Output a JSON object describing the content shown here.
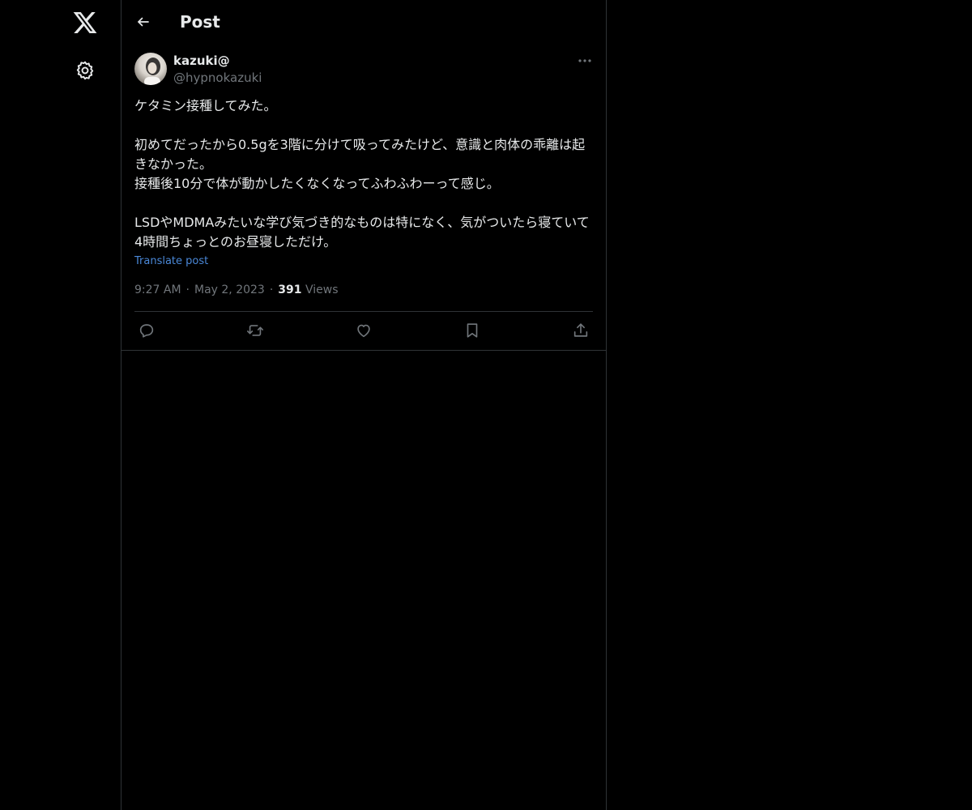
{
  "nav": {
    "logo_icon": "x-logo-icon",
    "settings_icon": "gear-icon"
  },
  "header": {
    "back_icon": "arrow-left-icon",
    "title": "Post"
  },
  "post": {
    "author": {
      "display_name": "kazuki@",
      "handle": "@hypnokazuki"
    },
    "more_icon": "ellipsis-icon",
    "text": "ケタミン接種してみた。\n\n初めてだったから0.5gを3階に分けて吸ってみたけど、意識と肉体の乖離は起きなかった。\n接種後10分で体が動かしたくなくなってふわふわーって感じ。\n\nLSDやMDMAみたいな学び気づき的なものは特になく、気がついたら寝ていて4時間ちょっとのお昼寝しただけ。",
    "translate_label": "Translate post",
    "time": "9:27 AM",
    "separator": "·",
    "date": "May 2, 2023",
    "views_count": "391",
    "views_label": "Views",
    "actions": [
      "reply-icon",
      "repost-icon",
      "like-icon",
      "bookmark-icon",
      "share-icon"
    ]
  },
  "colors": {
    "background": "#000000",
    "text": "#e7e9ea",
    "muted": "#71767b",
    "border": "#2f3336",
    "link": "#4a88d8"
  }
}
